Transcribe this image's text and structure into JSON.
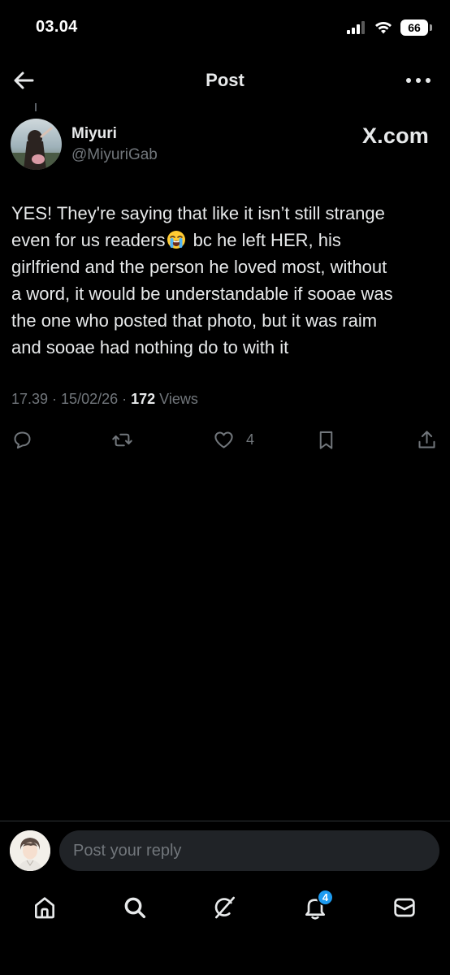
{
  "status_bar": {
    "time": "03.04",
    "battery": "66"
  },
  "header": {
    "title": "Post"
  },
  "author": {
    "name": "Miyuri",
    "handle": "@MiyuriGab",
    "source_label": "X.com"
  },
  "tweet": {
    "lines": [
      "YES! They're saying that like it isn’t still strange",
      "even for us readers",
      " bc he left HER, his",
      "girlfriend and the person he loved most, without",
      "a word, it would be understandable if sooae was",
      "the one who posted that photo, but it was raim",
      "and sooae had nothing do to with it"
    ],
    "emoji": "crying-face"
  },
  "meta": {
    "time": "17.39",
    "sep1": " · ",
    "date": "15/02/26",
    "sep2": " · ",
    "views_count": "172",
    "views_label": "Views"
  },
  "actions": {
    "reply_count": "",
    "repost_count": "",
    "like_count": "4"
  },
  "reply_bar": {
    "placeholder": "Post your reply"
  },
  "nav": {
    "notifications_badge": "4"
  },
  "colors": {
    "background": "#000000",
    "text": "#e7e9ea",
    "secondary": "#71767b",
    "accent": "#1d9bf0"
  }
}
